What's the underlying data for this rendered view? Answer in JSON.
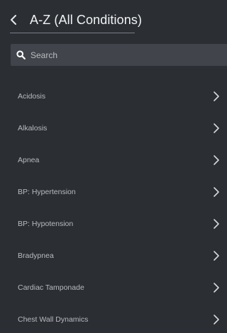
{
  "header": {
    "title": "A-Z (All Conditions)",
    "back_icon": "chevron-left-icon"
  },
  "search": {
    "placeholder": "Search",
    "value": "",
    "icon": "search-icon"
  },
  "conditions": [
    {
      "label": "Acidosis"
    },
    {
      "label": "Alkalosis"
    },
    {
      "label": "Apnea"
    },
    {
      "label": "BP: Hypertension"
    },
    {
      "label": "BP: Hypotension"
    },
    {
      "label": "Bradypnea"
    },
    {
      "label": "Cardiac Tamponade"
    },
    {
      "label": "Chest Wall Dynamics"
    }
  ],
  "item_icon": "chevron-right-icon",
  "colors": {
    "background": "#2b2e33",
    "search_bar": "#41454b",
    "text_primary": "#f1f3f4",
    "text_secondary": "#b8bbbf"
  }
}
